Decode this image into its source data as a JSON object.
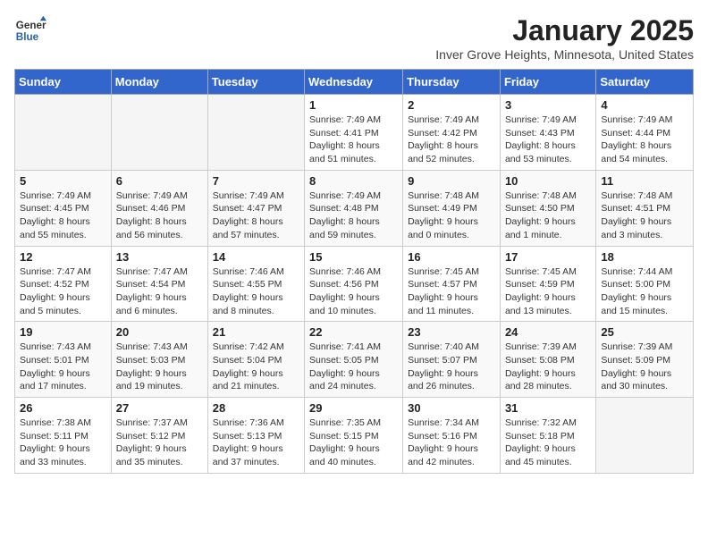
{
  "header": {
    "logo_general": "General",
    "logo_blue": "Blue",
    "month": "January 2025",
    "location": "Inver Grove Heights, Minnesota, United States"
  },
  "weekdays": [
    "Sunday",
    "Monday",
    "Tuesday",
    "Wednesday",
    "Thursday",
    "Friday",
    "Saturday"
  ],
  "weeks": [
    [
      {
        "day": "",
        "info": ""
      },
      {
        "day": "",
        "info": ""
      },
      {
        "day": "",
        "info": ""
      },
      {
        "day": "1",
        "info": "Sunrise: 7:49 AM\nSunset: 4:41 PM\nDaylight: 8 hours and 51 minutes."
      },
      {
        "day": "2",
        "info": "Sunrise: 7:49 AM\nSunset: 4:42 PM\nDaylight: 8 hours and 52 minutes."
      },
      {
        "day": "3",
        "info": "Sunrise: 7:49 AM\nSunset: 4:43 PM\nDaylight: 8 hours and 53 minutes."
      },
      {
        "day": "4",
        "info": "Sunrise: 7:49 AM\nSunset: 4:44 PM\nDaylight: 8 hours and 54 minutes."
      }
    ],
    [
      {
        "day": "5",
        "info": "Sunrise: 7:49 AM\nSunset: 4:45 PM\nDaylight: 8 hours and 55 minutes."
      },
      {
        "day": "6",
        "info": "Sunrise: 7:49 AM\nSunset: 4:46 PM\nDaylight: 8 hours and 56 minutes."
      },
      {
        "day": "7",
        "info": "Sunrise: 7:49 AM\nSunset: 4:47 PM\nDaylight: 8 hours and 57 minutes."
      },
      {
        "day": "8",
        "info": "Sunrise: 7:49 AM\nSunset: 4:48 PM\nDaylight: 8 hours and 59 minutes."
      },
      {
        "day": "9",
        "info": "Sunrise: 7:48 AM\nSunset: 4:49 PM\nDaylight: 9 hours and 0 minutes."
      },
      {
        "day": "10",
        "info": "Sunrise: 7:48 AM\nSunset: 4:50 PM\nDaylight: 9 hours and 1 minute."
      },
      {
        "day": "11",
        "info": "Sunrise: 7:48 AM\nSunset: 4:51 PM\nDaylight: 9 hours and 3 minutes."
      }
    ],
    [
      {
        "day": "12",
        "info": "Sunrise: 7:47 AM\nSunset: 4:52 PM\nDaylight: 9 hours and 5 minutes."
      },
      {
        "day": "13",
        "info": "Sunrise: 7:47 AM\nSunset: 4:54 PM\nDaylight: 9 hours and 6 minutes."
      },
      {
        "day": "14",
        "info": "Sunrise: 7:46 AM\nSunset: 4:55 PM\nDaylight: 9 hours and 8 minutes."
      },
      {
        "day": "15",
        "info": "Sunrise: 7:46 AM\nSunset: 4:56 PM\nDaylight: 9 hours and 10 minutes."
      },
      {
        "day": "16",
        "info": "Sunrise: 7:45 AM\nSunset: 4:57 PM\nDaylight: 9 hours and 11 minutes."
      },
      {
        "day": "17",
        "info": "Sunrise: 7:45 AM\nSunset: 4:59 PM\nDaylight: 9 hours and 13 minutes."
      },
      {
        "day": "18",
        "info": "Sunrise: 7:44 AM\nSunset: 5:00 PM\nDaylight: 9 hours and 15 minutes."
      }
    ],
    [
      {
        "day": "19",
        "info": "Sunrise: 7:43 AM\nSunset: 5:01 PM\nDaylight: 9 hours and 17 minutes."
      },
      {
        "day": "20",
        "info": "Sunrise: 7:43 AM\nSunset: 5:03 PM\nDaylight: 9 hours and 19 minutes."
      },
      {
        "day": "21",
        "info": "Sunrise: 7:42 AM\nSunset: 5:04 PM\nDaylight: 9 hours and 21 minutes."
      },
      {
        "day": "22",
        "info": "Sunrise: 7:41 AM\nSunset: 5:05 PM\nDaylight: 9 hours and 24 minutes."
      },
      {
        "day": "23",
        "info": "Sunrise: 7:40 AM\nSunset: 5:07 PM\nDaylight: 9 hours and 26 minutes."
      },
      {
        "day": "24",
        "info": "Sunrise: 7:39 AM\nSunset: 5:08 PM\nDaylight: 9 hours and 28 minutes."
      },
      {
        "day": "25",
        "info": "Sunrise: 7:39 AM\nSunset: 5:09 PM\nDaylight: 9 hours and 30 minutes."
      }
    ],
    [
      {
        "day": "26",
        "info": "Sunrise: 7:38 AM\nSunset: 5:11 PM\nDaylight: 9 hours and 33 minutes."
      },
      {
        "day": "27",
        "info": "Sunrise: 7:37 AM\nSunset: 5:12 PM\nDaylight: 9 hours and 35 minutes."
      },
      {
        "day": "28",
        "info": "Sunrise: 7:36 AM\nSunset: 5:13 PM\nDaylight: 9 hours and 37 minutes."
      },
      {
        "day": "29",
        "info": "Sunrise: 7:35 AM\nSunset: 5:15 PM\nDaylight: 9 hours and 40 minutes."
      },
      {
        "day": "30",
        "info": "Sunrise: 7:34 AM\nSunset: 5:16 PM\nDaylight: 9 hours and 42 minutes."
      },
      {
        "day": "31",
        "info": "Sunrise: 7:32 AM\nSunset: 5:18 PM\nDaylight: 9 hours and 45 minutes."
      },
      {
        "day": "",
        "info": ""
      }
    ]
  ]
}
